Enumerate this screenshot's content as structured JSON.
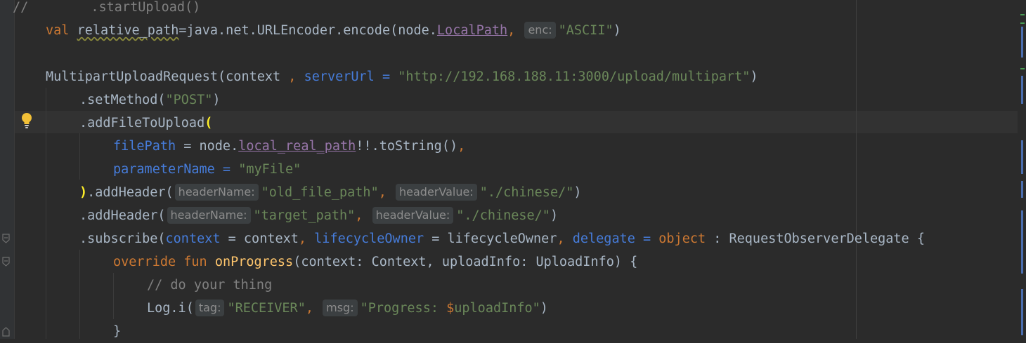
{
  "editor": {
    "lines": {
      "l1": {
        "comment": "//",
        "call": "        .startUpload()"
      },
      "l2": {
        "kw_val": "val",
        "varname": "relative_path",
        "eq": "=java.net.URLEncoder.encode(node.",
        "prop": "LocalPath",
        "comma": ", ",
        "hint": "enc:",
        "arg": "\"ASCII\"",
        "close": ")"
      },
      "l4": {
        "cls": "MultipartUploadRequest(context ",
        "comma": ", ",
        "named": "serverUrl",
        "eq": " = ",
        "url": "\"http://192.168.188.11:3000/upload/multipart\"",
        "close": ")"
      },
      "l5": {
        "call": ".setMethod(",
        "arg": "\"POST\"",
        "close": ")"
      },
      "l6": {
        "call": ".addFileToUpload",
        "paren": "("
      },
      "l7": {
        "named": "filePath",
        "eq": " = node.",
        "prop": "local_real_path",
        "rest": "!!.toString()",
        "comma": ","
      },
      "l8": {
        "named": "parameterName",
        "eq": " = ",
        "arg": "\"myFile\""
      },
      "l9": {
        "paren": ")",
        "call": ".addHeader(",
        "hint1": "headerName:",
        "arg1": "\"old_file_path\"",
        "comma": ", ",
        "hint2": "headerValue:",
        "arg2": "\"./chinese/\"",
        "close": ")"
      },
      "l10": {
        "call": ".addHeader(",
        "hint1": "headerName:",
        "arg1": "\"target_path\"",
        "comma": ", ",
        "hint2": "headerValue:",
        "arg2": "\"./chinese/\"",
        "close": ")"
      },
      "l11": {
        "call": ".subscribe(",
        "named1": "context",
        "eq1": " = context",
        "c1": ", ",
        "named2": "lifecycleOwner",
        "eq2": " = lifecycleOwner",
        "c2": ", ",
        "named3": "delegate",
        "eq3": " = ",
        "kw_object": "object",
        "rest": " : RequestObserverDelegate {"
      },
      "l12": {
        "kw_override": "override",
        "kw_fun": "fun",
        "fn": "onProgress",
        "params": "(context: Context, uploadInfo: UploadInfo) {"
      },
      "l13": {
        "comment": "// do your thing"
      },
      "l14": {
        "call": "Log.i(",
        "hint1": "tag:",
        "arg1": "\"RECEIVER\"",
        "comma": ", ",
        "hint2": "msg:",
        "arg2a": "\"Progress: ",
        "tmpl": "$",
        "arg2b": "uploadInfo\"",
        "close": ")"
      },
      "l15": {
        "brace": "}"
      }
    }
  },
  "colors": {
    "background": "#2b2b2b",
    "keyword": "#cc7832",
    "string": "#6a8759",
    "named_arg": "#467cda",
    "property": "#9876aa",
    "function": "#ffc66d",
    "comment": "#808080",
    "default_text": "#a9b7c6"
  },
  "icons": [
    "lightbulb-icon",
    "fold-marker-icon"
  ]
}
